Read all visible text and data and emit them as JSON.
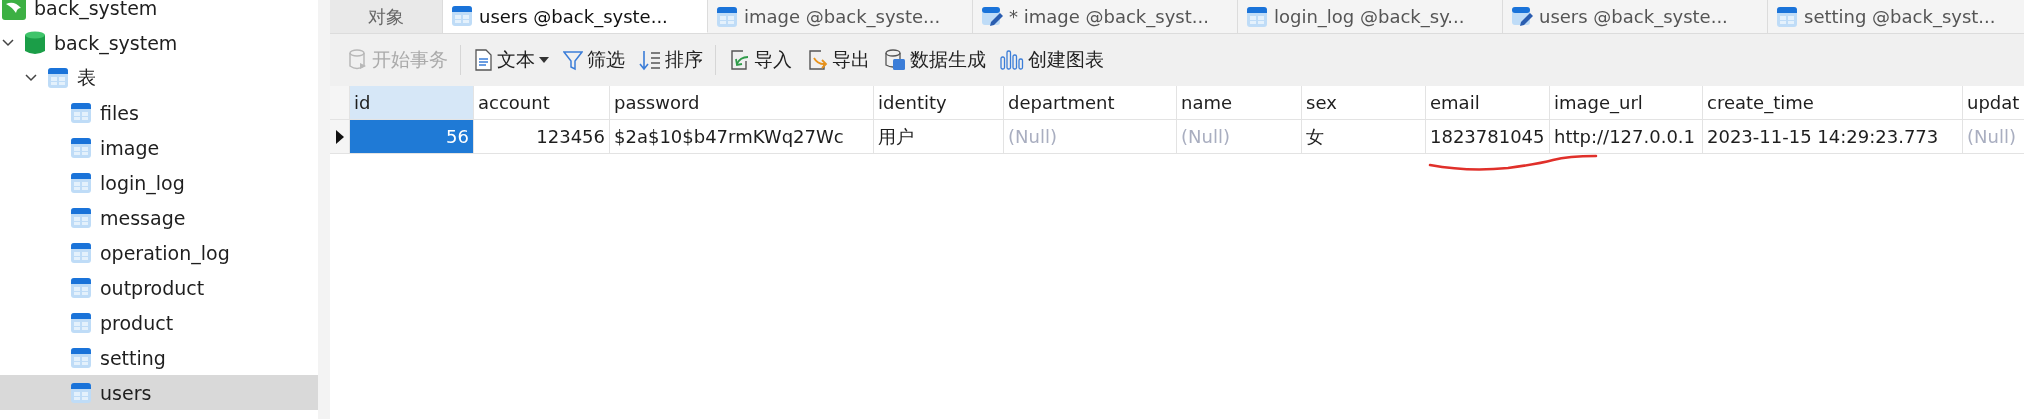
{
  "sidebar": {
    "connection": {
      "label": "back_system"
    },
    "tree": [
      {
        "label": "back_system",
        "kind": "database",
        "expanded": true,
        "children": [
          {
            "label": "表",
            "kind": "folder",
            "expanded": true,
            "children": [
              {
                "label": "files",
                "kind": "table",
                "selected": false
              },
              {
                "label": "image",
                "kind": "table",
                "selected": false
              },
              {
                "label": "login_log",
                "kind": "table",
                "selected": false
              },
              {
                "label": "message",
                "kind": "table",
                "selected": false
              },
              {
                "label": "operation_log",
                "kind": "table",
                "selected": false
              },
              {
                "label": "outproduct",
                "kind": "table",
                "selected": false
              },
              {
                "label": "product",
                "kind": "table",
                "selected": false
              },
              {
                "label": "setting",
                "kind": "table",
                "selected": false
              },
              {
                "label": "users",
                "kind": "table",
                "selected": true
              }
            ]
          }
        ]
      }
    ]
  },
  "tabs": [
    {
      "label": "对象",
      "kind": "objects",
      "selected": false
    },
    {
      "label": "users @back_syste...",
      "kind": "table",
      "selected": true
    },
    {
      "label": "image @back_syste...",
      "kind": "table",
      "selected": false
    },
    {
      "label": "* image @back_syst...",
      "kind": "design",
      "selected": false
    },
    {
      "label": "login_log @back_sy...",
      "kind": "table",
      "selected": false
    },
    {
      "label": "users @back_syste...",
      "kind": "design",
      "selected": false
    },
    {
      "label": "setting @back_syst...",
      "kind": "table",
      "selected": false
    }
  ],
  "toolbar": [
    [
      {
        "label": "开始事务",
        "kind": "transaction",
        "disabled": true,
        "dropdown": false
      }
    ],
    [
      {
        "label": "文本",
        "kind": "text",
        "disabled": false,
        "dropdown": true
      },
      {
        "label": "筛选",
        "kind": "filter",
        "disabled": false,
        "dropdown": false
      },
      {
        "label": "排序",
        "kind": "sort",
        "disabled": false,
        "dropdown": false
      }
    ],
    [
      {
        "label": "导入",
        "kind": "import",
        "disabled": false,
        "dropdown": false
      },
      {
        "label": "导出",
        "kind": "export",
        "disabled": false,
        "dropdown": false
      },
      {
        "label": "数据生成",
        "kind": "generate",
        "disabled": false,
        "dropdown": false
      },
      {
        "label": "创建图表",
        "kind": "chart",
        "disabled": false,
        "dropdown": false
      }
    ]
  ],
  "table": {
    "columns": [
      {
        "label": "id",
        "selected": true
      },
      {
        "label": "account",
        "selected": false
      },
      {
        "label": "password",
        "selected": false
      },
      {
        "label": "identity",
        "selected": false
      },
      {
        "label": "department",
        "selected": false
      },
      {
        "label": "name",
        "selected": false
      },
      {
        "label": "sex",
        "selected": false
      },
      {
        "label": "email",
        "selected": false
      },
      {
        "label": "image_url",
        "selected": false
      },
      {
        "label": "create_time",
        "selected": false
      },
      {
        "label": "updat",
        "selected": false
      }
    ],
    "rows": [
      {
        "current": true,
        "cells": [
          {
            "text": "56",
            "kind": "number",
            "selected": true
          },
          {
            "text": "123456",
            "kind": "number",
            "selected": false
          },
          {
            "text": "$2a$10$b47rmKWq27Wc",
            "kind": "text",
            "selected": false
          },
          {
            "text": "用户",
            "kind": "text",
            "selected": false
          },
          {
            "text": "(Null)",
            "kind": "null",
            "selected": false
          },
          {
            "text": "(Null)",
            "kind": "null",
            "selected": false
          },
          {
            "text": "女",
            "kind": "text",
            "selected": false
          },
          {
            "text": "1823781045",
            "kind": "text",
            "selected": false
          },
          {
            "text": "http://127.0.0.1",
            "kind": "text",
            "selected": false
          },
          {
            "text": "2023-11-15 14:29:23.773",
            "kind": "text",
            "selected": false
          },
          {
            "text": "(Null)",
            "kind": "null",
            "selected": false
          }
        ]
      }
    ]
  }
}
